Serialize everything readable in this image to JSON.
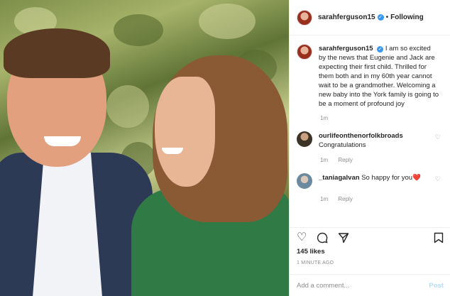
{
  "post": {
    "username": "sarahferguson15",
    "verified_mark": "✓",
    "separator": "•",
    "follow_label": "Following"
  },
  "caption": {
    "username": "sarahferguson15",
    "text": "I am so excited by the news that Eugenie and Jack are expecting their first child. Thrilled for them both and in my 60th year cannot wait to be a grandmother. Welcoming a new baby into the York family is going to be a moment of profound joy",
    "age": "1m"
  },
  "comments": [
    {
      "username": "ourlifeonthenorfolkbroads",
      "text": "Congratulations",
      "age": "1m",
      "reply_label": "Reply"
    },
    {
      "username": "_taniagalvan",
      "text": "So happy for you",
      "emoji": "❤️",
      "age": "1m",
      "reply_label": "Reply"
    }
  ],
  "actions": {
    "like_icon": "heart-icon",
    "comment_icon": "comment-icon",
    "share_icon": "share-icon",
    "save_icon": "bookmark-icon"
  },
  "likes_text": "145 likes",
  "timestamp": "1 MINUTE AGO",
  "add_comment": {
    "placeholder": "Add a comment...",
    "post_label": "Post"
  }
}
